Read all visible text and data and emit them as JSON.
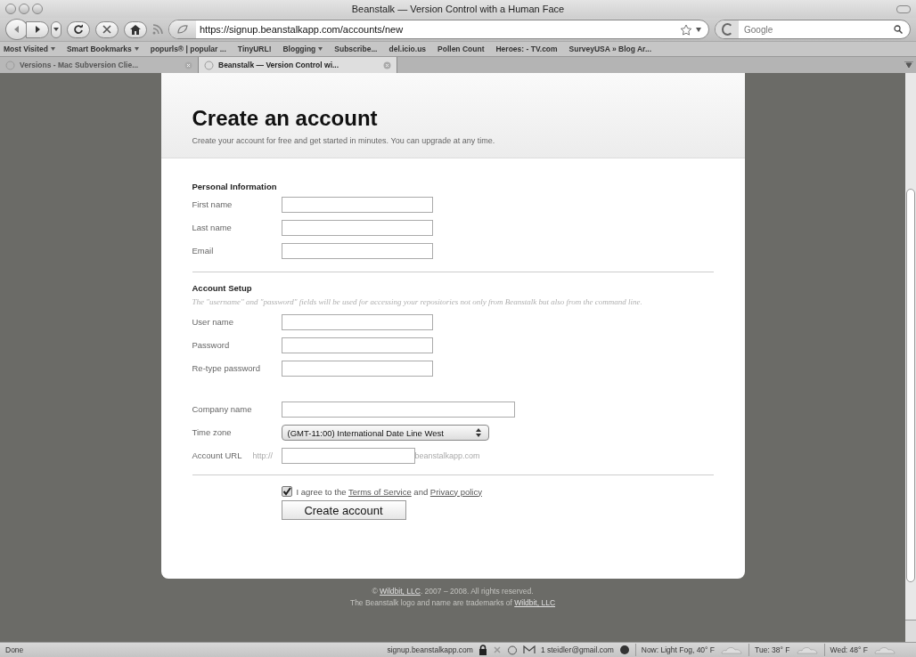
{
  "window": {
    "title": "Beanstalk — Version Control with a Human Face"
  },
  "toolbar": {
    "url": "https://signup.beanstalkapp.com/accounts/new",
    "search_placeholder": "Google"
  },
  "bookmarks": [
    {
      "label": "Most Visited",
      "folder": true
    },
    {
      "label": "Smart Bookmarks",
      "folder": true
    },
    {
      "label": "popurls® | popular ...",
      "folder": false
    },
    {
      "label": "TinyURL!",
      "folder": false
    },
    {
      "label": "Blogging",
      "folder": true
    },
    {
      "label": "Subscribe...",
      "folder": false
    },
    {
      "label": "del.icio.us",
      "folder": false
    },
    {
      "label": "Pollen Count",
      "folder": false
    },
    {
      "label": "Heroes: - TV.com",
      "folder": false
    },
    {
      "label": "SurveyUSA » Blog Ar...",
      "folder": false
    }
  ],
  "tabs": [
    {
      "label": "Versions - Mac Subversion Clie...",
      "selected": false
    },
    {
      "label": "Beanstalk — Version Control wi...",
      "selected": true
    }
  ],
  "page": {
    "heading": "Create an account",
    "subheading": "Create your account for free and get started in minutes. You can upgrade at any time.",
    "sections": [
      {
        "title": "Personal Information",
        "groups": [
          [
            {
              "label": "First name",
              "kind": "text"
            },
            {
              "label": "Last name",
              "kind": "text"
            },
            {
              "label": "Email",
              "kind": "text"
            }
          ]
        ]
      },
      {
        "title": "Account Setup",
        "note": "The \"username\" and \"password\" fields will be used for accessing your repositories not only from Beanstalk but also from the command line.",
        "groups": [
          [
            {
              "label": "User name",
              "kind": "text"
            },
            {
              "label": "Password",
              "kind": "text"
            },
            {
              "label": "Re-type password",
              "kind": "text"
            }
          ],
          [
            {
              "label": "Company name",
              "kind": "wide"
            },
            {
              "label": "Time zone",
              "kind": "select",
              "value": "(GMT-11:00) International Date Line West"
            },
            {
              "label": "Account URL",
              "kind": "url",
              "prefix": "http://",
              "suffix": "beanstalkapp.com"
            }
          ]
        ]
      }
    ],
    "agree": {
      "checked": true,
      "before": "I agree to the",
      "link1": "Terms of Service",
      "middle": "and",
      "link2": "Privacy policy"
    },
    "submit": "Create account",
    "footer": {
      "line1_before": "©",
      "line1_link": "Wildbit, LLC",
      "line1_after": ". 2007 – 2008. All rights reserved.",
      "line2_before": "The Beanstalk logo and name are trademarks of",
      "line2_link": "Wildbit, LLC"
    }
  },
  "status_bar": {
    "status": "Done",
    "host": "signup.beanstalkapp.com",
    "gmail": "1 steidler@gmail.com",
    "weather": [
      "Now: Light Fog, 40° F",
      "Tue: 38° F",
      "Wed: 48° F"
    ]
  }
}
